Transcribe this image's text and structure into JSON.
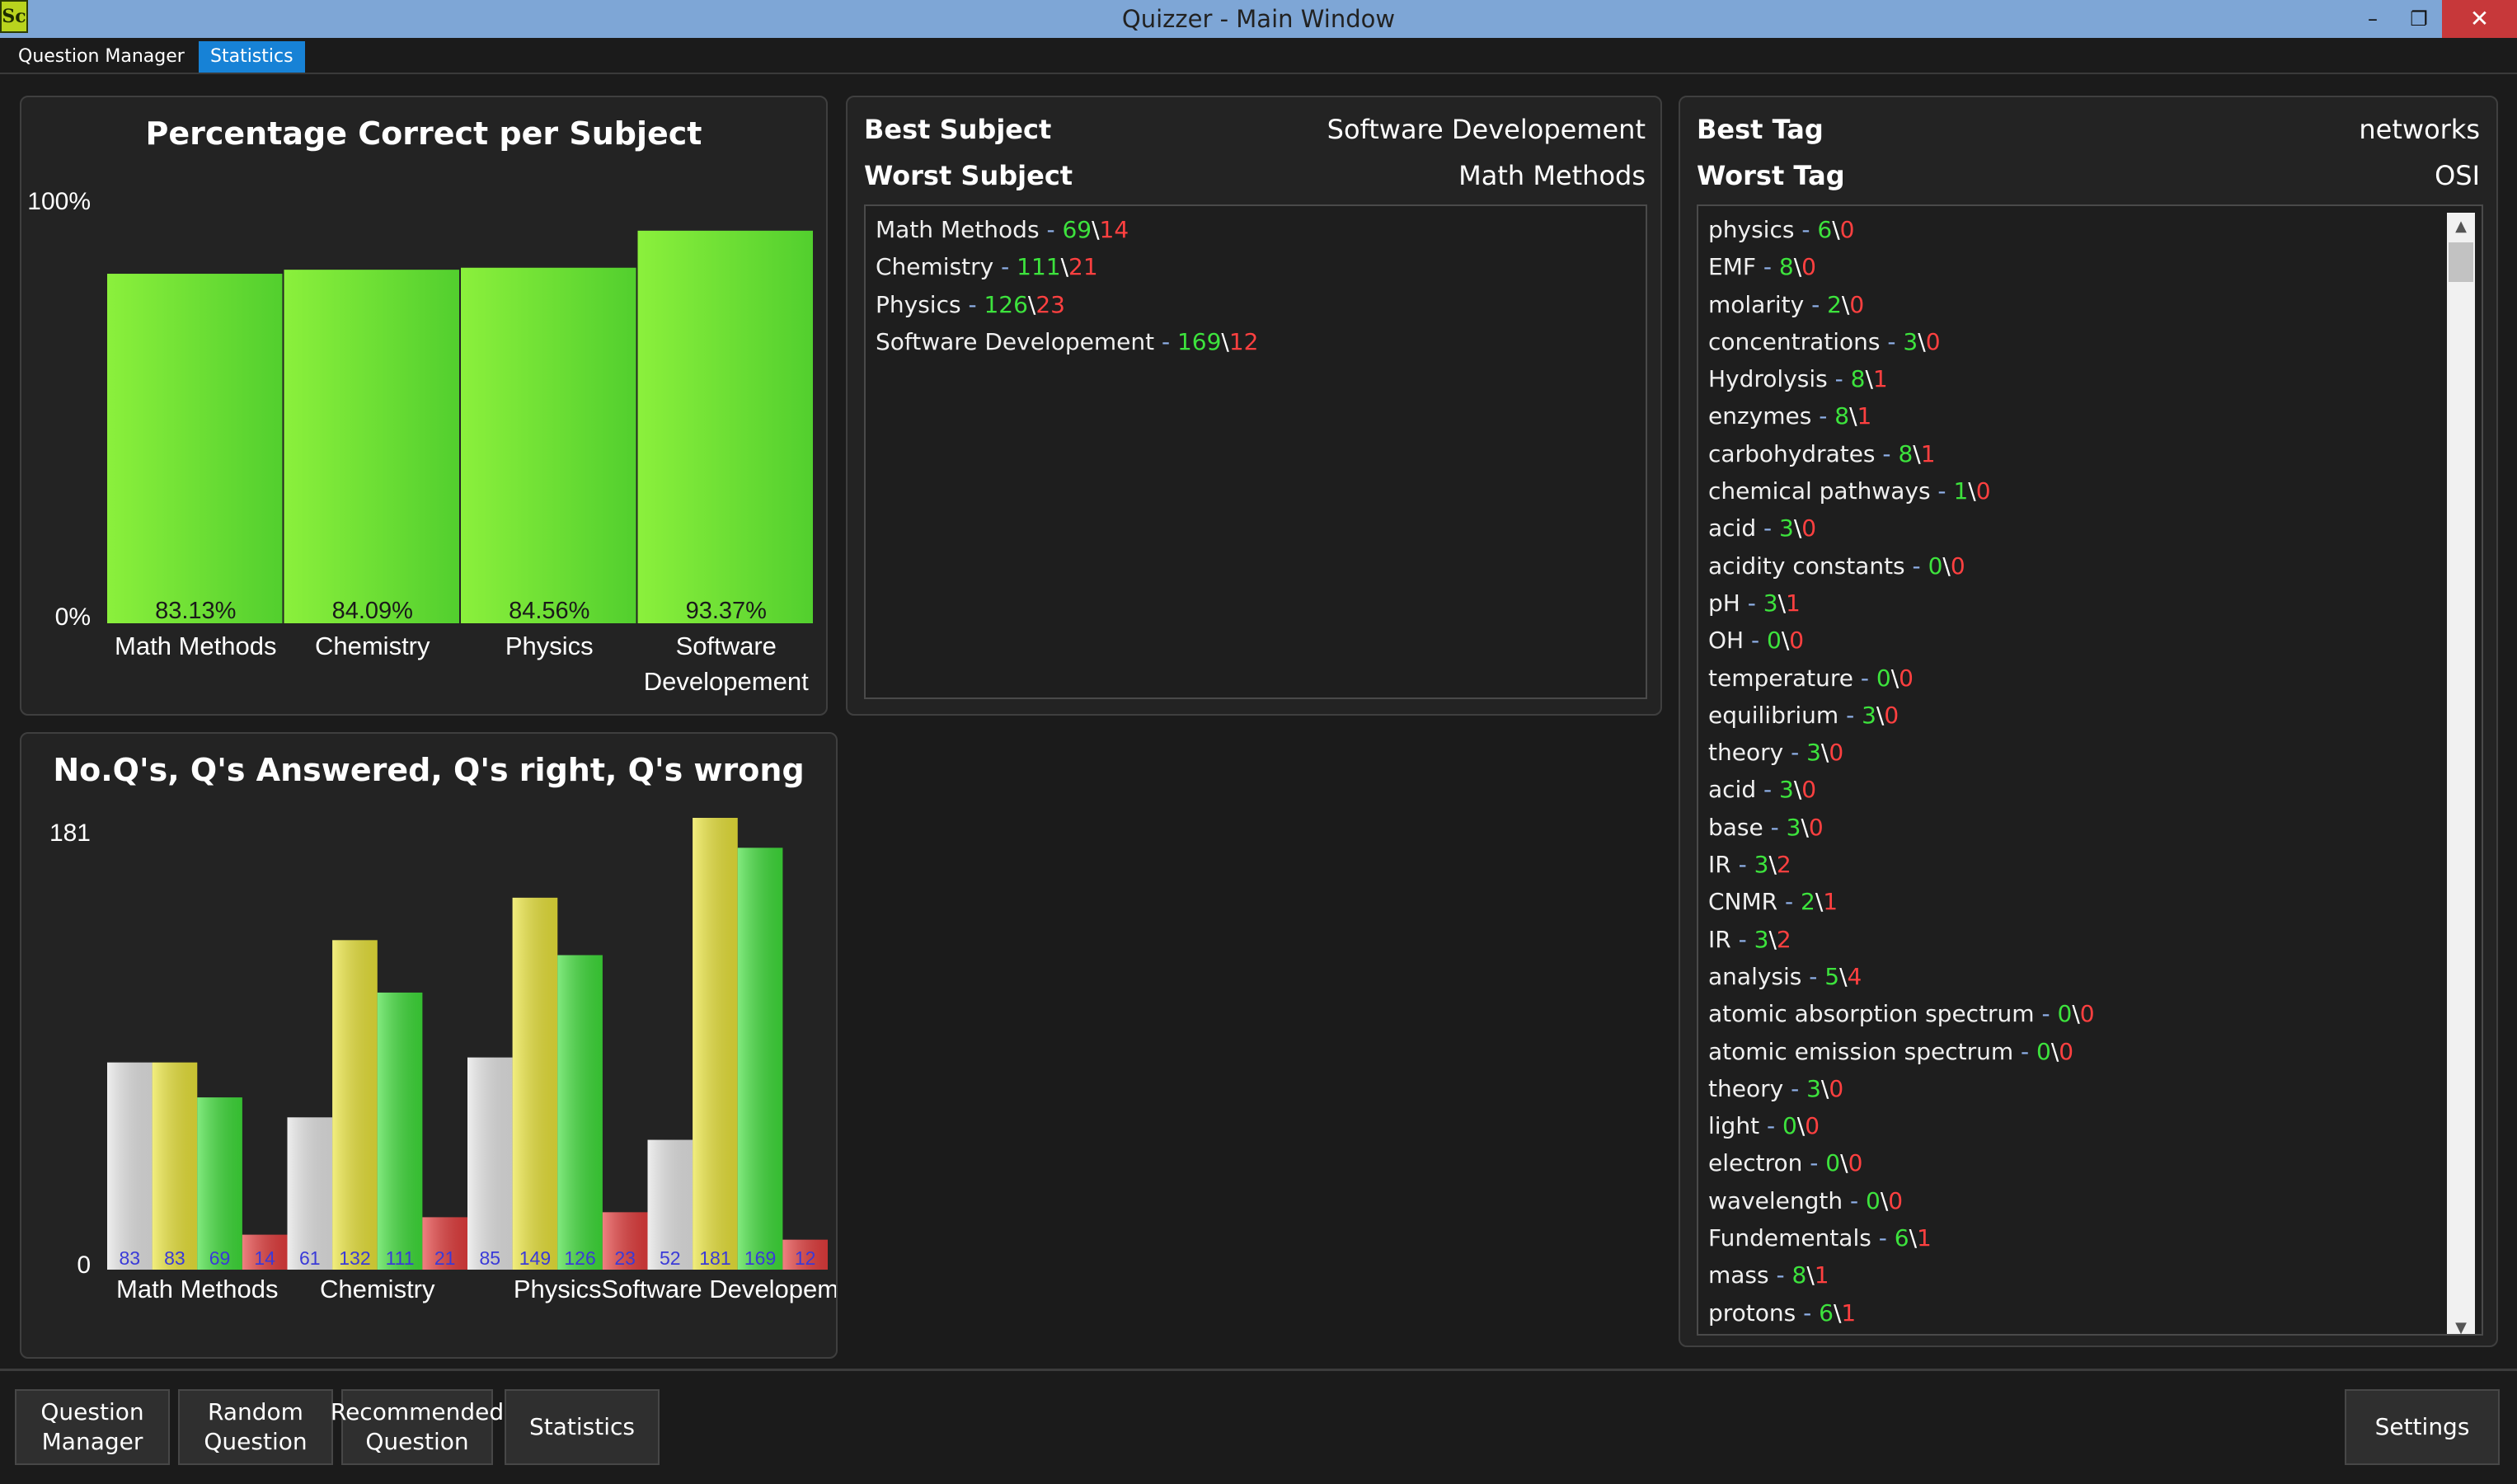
{
  "window": {
    "icon_text": "Sc",
    "title": "Quizzer - Main Window",
    "min_glyph": "–",
    "max_glyph": "❐",
    "close_glyph": "✕"
  },
  "tabs": [
    {
      "label": "Question Manager",
      "active": false
    },
    {
      "label": "Statistics",
      "active": true
    }
  ],
  "subjects_summary": {
    "best_label": "Best Subject",
    "best_value": "Software Developement",
    "worst_label": "Worst Subject",
    "worst_value": "Math Methods",
    "list": [
      {
        "name": "Math Methods",
        "right": "69",
        "wrong": "14"
      },
      {
        "name": "Chemistry",
        "right": "111",
        "wrong": "21"
      },
      {
        "name": "Physics",
        "right": "126",
        "wrong": "23"
      },
      {
        "name": "Software Developement",
        "right": "169",
        "wrong": "12"
      }
    ]
  },
  "tags_summary": {
    "best_label": "Best Tag",
    "best_value": "networks",
    "worst_label": "Worst Tag",
    "worst_value": "OSI",
    "list": [
      {
        "name": "physics",
        "right": "6",
        "wrong": "0"
      },
      {
        "name": "EMF",
        "right": "8",
        "wrong": "0"
      },
      {
        "name": "molarity",
        "right": "2",
        "wrong": "0"
      },
      {
        "name": "concentrations",
        "right": "3",
        "wrong": "0"
      },
      {
        "name": "Hydrolysis",
        "right": "8",
        "wrong": "1"
      },
      {
        "name": "enzymes",
        "right": "8",
        "wrong": "1"
      },
      {
        "name": "carbohydrates",
        "right": "8",
        "wrong": "1"
      },
      {
        "name": "chemical pathways",
        "right": "1",
        "wrong": "0"
      },
      {
        "name": "acid",
        "right": "3",
        "wrong": "0"
      },
      {
        "name": "acidity constants",
        "right": "0",
        "wrong": "0"
      },
      {
        "name": "pH",
        "right": "3",
        "wrong": "1"
      },
      {
        "name": "OH",
        "right": "0",
        "wrong": "0"
      },
      {
        "name": "temperature",
        "right": "0",
        "wrong": "0"
      },
      {
        "name": "equilibrium",
        "right": "3",
        "wrong": "0"
      },
      {
        "name": "theory",
        "right": "3",
        "wrong": "0"
      },
      {
        "name": "acid",
        "right": "3",
        "wrong": "0"
      },
      {
        "name": "base",
        "right": "3",
        "wrong": "0"
      },
      {
        "name": "IR",
        "right": "3",
        "wrong": "2"
      },
      {
        "name": "CNMR",
        "right": "2",
        "wrong": "1"
      },
      {
        "name": "IR",
        "right": "3",
        "wrong": "2"
      },
      {
        "name": "analysis",
        "right": "5",
        "wrong": "4"
      },
      {
        "name": "atomic absorption spectrum",
        "right": "0",
        "wrong": "0"
      },
      {
        "name": "atomic emission spectrum",
        "right": "0",
        "wrong": "0"
      },
      {
        "name": "theory",
        "right": "3",
        "wrong": "0"
      },
      {
        "name": "light",
        "right": "0",
        "wrong": "0"
      },
      {
        "name": "electron",
        "right": "0",
        "wrong": "0"
      },
      {
        "name": "wavelength",
        "right": "0",
        "wrong": "0"
      },
      {
        "name": "Fundementals",
        "right": "6",
        "wrong": "1"
      },
      {
        "name": "mass",
        "right": "8",
        "wrong": "1"
      },
      {
        "name": "protons",
        "right": "6",
        "wrong": "1"
      }
    ],
    "scroll_up_glyph": "▲",
    "scroll_down_glyph": "▼"
  },
  "bottom_nav": {
    "question_manager": "Question\nManager",
    "random_question": "Random\nQuestion",
    "recommended_question": "Recommended\nQuestion",
    "statistics": "Statistics",
    "settings": "Settings"
  },
  "chart_data": [
    {
      "type": "bar",
      "title": "Percentage Correct per Subject",
      "categories": [
        "Math Methods",
        "Chemistry",
        "Physics",
        "Software Developement"
      ],
      "category_lines": [
        [
          "Math Methods"
        ],
        [
          "Chemistry"
        ],
        [
          "Physics"
        ],
        [
          "Software",
          "Developement"
        ]
      ],
      "values": [
        83.13,
        84.09,
        84.56,
        93.37
      ],
      "value_labels": [
        "83.13%",
        "84.09%",
        "84.56%",
        "93.37%"
      ],
      "ylim": [
        0,
        100
      ],
      "ytick_top": "100%",
      "ytick_bottom": "0%",
      "color": "#5ee23a",
      "grid": false,
      "legend": "none"
    },
    {
      "type": "bar",
      "title": "No.Q's, Q's Answered, Q's right, Q's wrong",
      "categories": [
        "Math Methods",
        "Chemistry",
        "Physics",
        "Software Developement"
      ],
      "series": [
        {
          "values": [
            83,
            61,
            85,
            52
          ],
          "color": "#e6e6e6"
        },
        {
          "values": [
            83,
            132,
            149,
            181
          ],
          "color": "#ebe53a"
        },
        {
          "values": [
            69,
            111,
            126,
            169
          ],
          "color": "#3fdf3a"
        },
        {
          "values": [
            14,
            21,
            23,
            12
          ],
          "color": "#e53d3d"
        }
      ],
      "ylim": [
        0,
        181
      ],
      "ytick_top": "181",
      "ytick_bottom": "0",
      "value_label_color": "#3a3ad8",
      "grid": false,
      "legend": "none"
    }
  ]
}
